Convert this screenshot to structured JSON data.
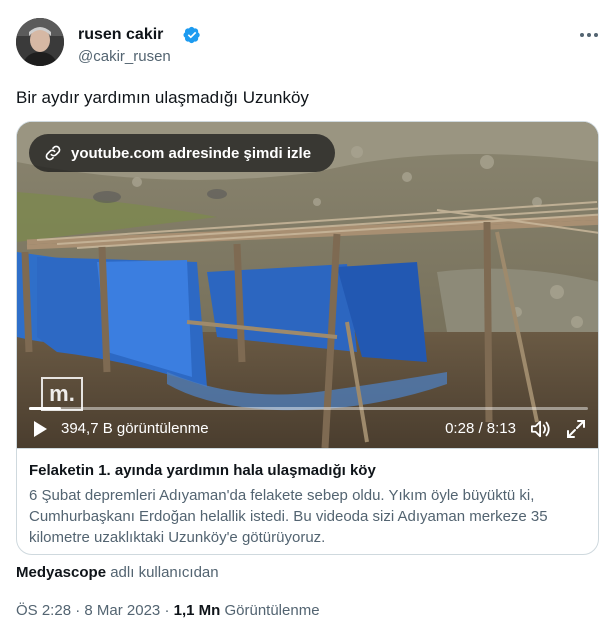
{
  "author": {
    "display_name": "rusen cakir",
    "handle": "@cakir_rusen",
    "verified": true,
    "avatar_icon": "avatar-photo"
  },
  "tweet": {
    "text": "Bir aydır yardımın ulaşmadığı Uzunköy"
  },
  "video": {
    "open_link_label": "youtube.com adresinde şimdi izle",
    "watermark": "m.",
    "views": "394,7 B görüntülenme",
    "time": "0:28 / 8:13",
    "progress_fraction": 0.057,
    "icons": [
      "link-icon",
      "play-icon",
      "volume-icon",
      "fullscreen-icon"
    ]
  },
  "card": {
    "title": "Felaketin 1. ayında yardımın hala ulaşmadığı köy",
    "description": "6 Şubat depremleri Adıyaman'da felakete sebep oldu. Yıkım öyle büyüktü ki, Cumhurbaşkanı Erdoğan helallik istedi. Bu videoda sizi Adıyaman merkeze 35 kilometre uzaklıktaki Uzunköy'e götürüyoruz."
  },
  "source": {
    "name": "Medyascope",
    "suffix": " adlı kullanıcıdan"
  },
  "meta": {
    "time": "ÖS 2:28",
    "separator": " · ",
    "date": "8 Mar 2023",
    "separator2": " · ",
    "views_count": "1,1 Mn",
    "views_label": " Görüntülenme"
  },
  "colors": {
    "verified_blue": "#1d9bf0",
    "text_primary": "#0f1419",
    "text_secondary": "#536471",
    "border": "#cfd9de"
  }
}
